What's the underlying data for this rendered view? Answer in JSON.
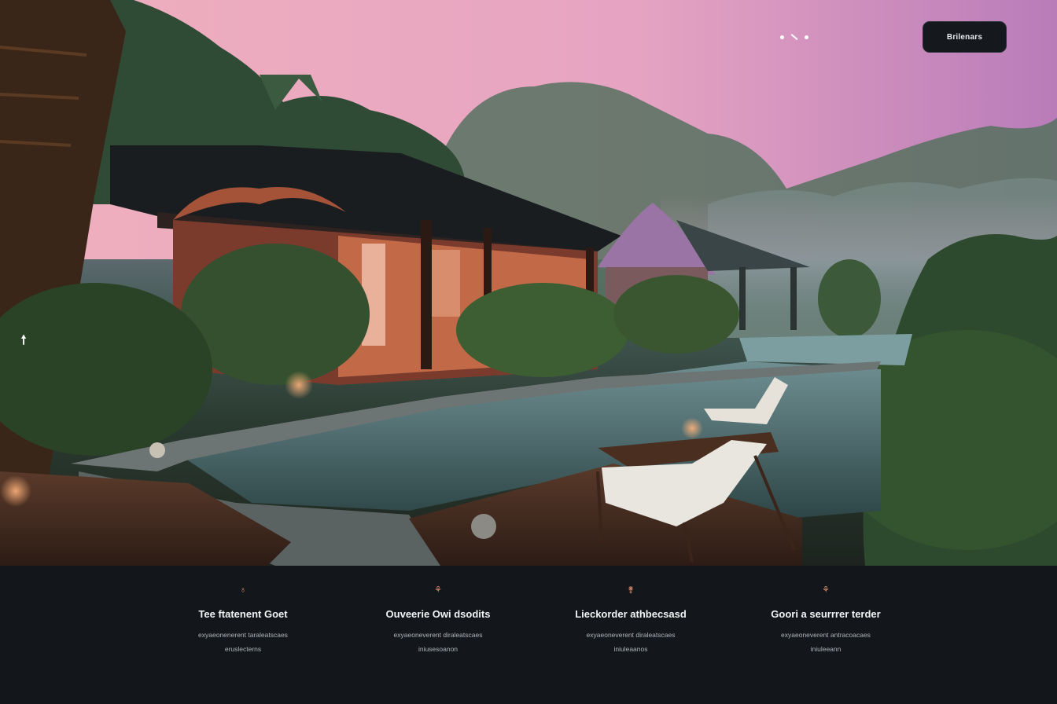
{
  "header": {
    "menu_icon": "menu-dots-icon",
    "cta_label": "Brilenars"
  },
  "hero": {
    "scroll_icon": "arrow-up-icon",
    "scroll_glyph": "🠕"
  },
  "features": [
    {
      "icon": "leaf-icon",
      "glyph": "♁",
      "title": "Tee ftatenent Goet",
      "description": "exyaeonenerent taraleatscaes eruslecterns"
    },
    {
      "icon": "sprout-icon",
      "glyph": "⚘",
      "title": "Ouveerie Owi dsodits",
      "description": "exyaeoneverent diraleatscaes iniusesoanon"
    },
    {
      "icon": "tree-icon",
      "glyph": "⚵",
      "title": "Lieckorder athbecsasd",
      "description": "exyaeoneverent diraleatscaes iniuleaanos"
    },
    {
      "icon": "flower-icon",
      "glyph": "⚘",
      "title": "Goori a seurrrer terder",
      "description": "exyaeoneverent antracoacaes iniuleeann"
    }
  ],
  "colors": {
    "footer_bg": "#13171b",
    "accent_icon": "#d88b6a",
    "sky_pink": "#e8a3b5",
    "pool_teal": "#3e5a5c"
  }
}
